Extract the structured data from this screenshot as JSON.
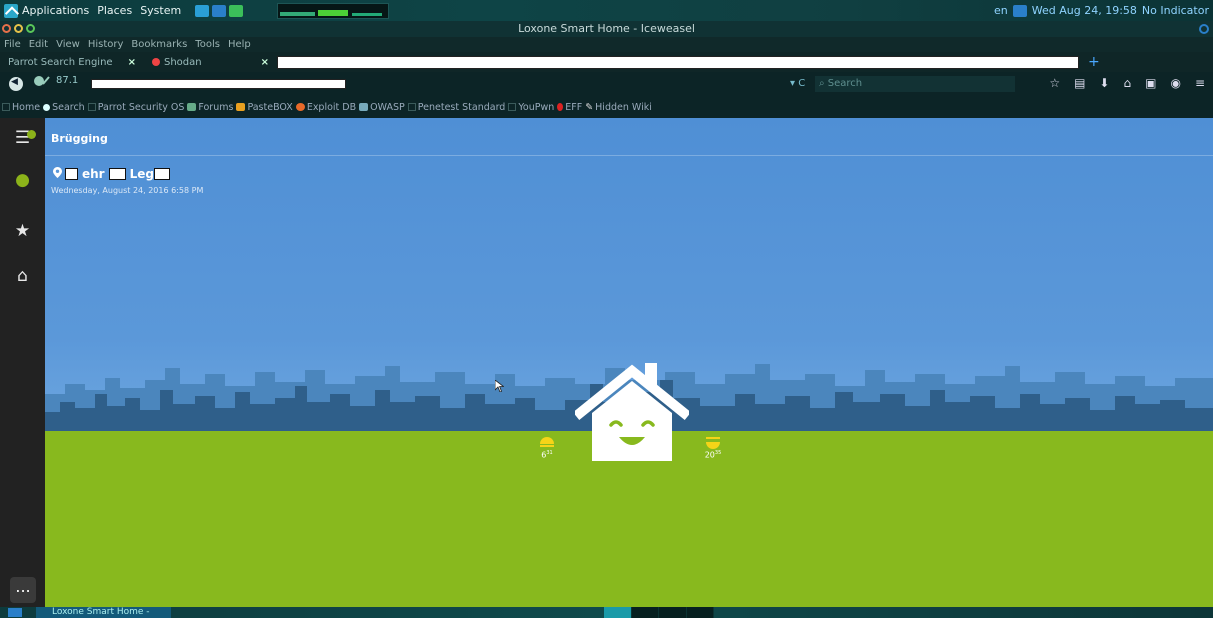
{
  "top_panel": {
    "menus": [
      "Applications",
      "Places",
      "System"
    ],
    "keyboard": "en",
    "clock": "Wed Aug 24, 19:58",
    "indicator": "No Indicator"
  },
  "window": {
    "title": "Loxone Smart Home - Iceweasel"
  },
  "menubar": [
    "File",
    "Edit",
    "View",
    "History",
    "Bookmarks",
    "Tools",
    "Help"
  ],
  "tabs": [
    {
      "label": "Parrot Search Engine"
    },
    {
      "label": "Shodan"
    }
  ],
  "navbar": {
    "url_prefix": "87.1",
    "search_placeholder": "Search"
  },
  "bookmarks": [
    "Home",
    "Search",
    "Parrot Security OS",
    "Forums",
    "PasteBOX",
    "Exploit DB",
    "OWASP",
    "Penetest Standard",
    "YouPwn",
    "EFF",
    "Hidden Wiki"
  ],
  "app": {
    "title": "Brügging",
    "location_parts": [
      "ehr",
      "Leg"
    ],
    "date": "Wednesday, August 24, 2016  6:58 PM",
    "temp_left": "6",
    "temp_left_sup": "31",
    "temp_right": "20",
    "temp_right_sup": "35",
    "more_label": "..."
  },
  "taskbar": {
    "item": "Loxone Smart Home -"
  },
  "colors": {
    "sky": "#5b98d9",
    "grass": "#88b91e",
    "skyline_dark": "#2f5f8a",
    "accent_green": "#8cb31a",
    "sun_yellow": "#f5d418"
  }
}
